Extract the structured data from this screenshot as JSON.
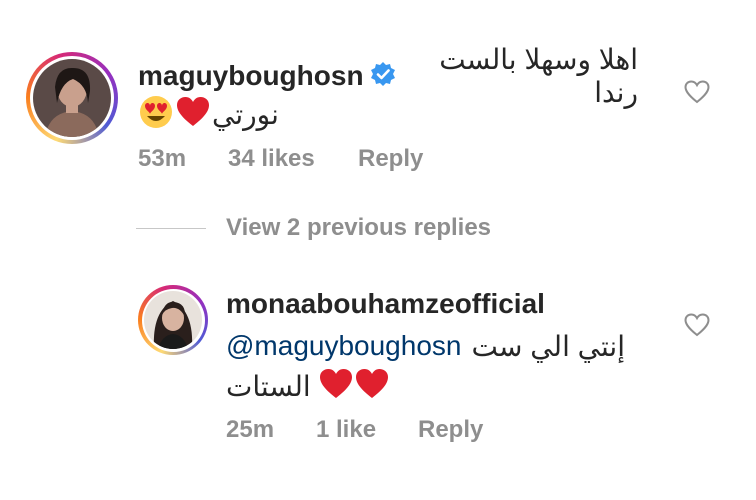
{
  "comments": [
    {
      "username": "maguyboughosn",
      "verified": true,
      "text_line1": "اهلا وسهلا بالست رندا",
      "text_line2": "نورتي",
      "time": "53m",
      "likes": "34 likes",
      "reply_label": "Reply"
    },
    {
      "username": "monaabouhamzeofficial",
      "verified": false,
      "mention": "@maguyboughosn",
      "text_line1": "إنتي الي ست",
      "text_line2": "الستات",
      "time": "25m",
      "likes": "1 like",
      "reply_label": "Reply"
    }
  ],
  "view_replies": "View 2 previous replies",
  "colors": {
    "text": "#262626",
    "secondary": "#8e8e8e",
    "mention": "#00376b",
    "verified": "#3897f0",
    "heart_emoji": "#e0202e"
  },
  "icons": {
    "verified": "verified-badge-icon",
    "like": "heart-outline-icon",
    "emoji_heart": "red-heart-emoji",
    "emoji_love": "heart-eyes-emoji"
  }
}
